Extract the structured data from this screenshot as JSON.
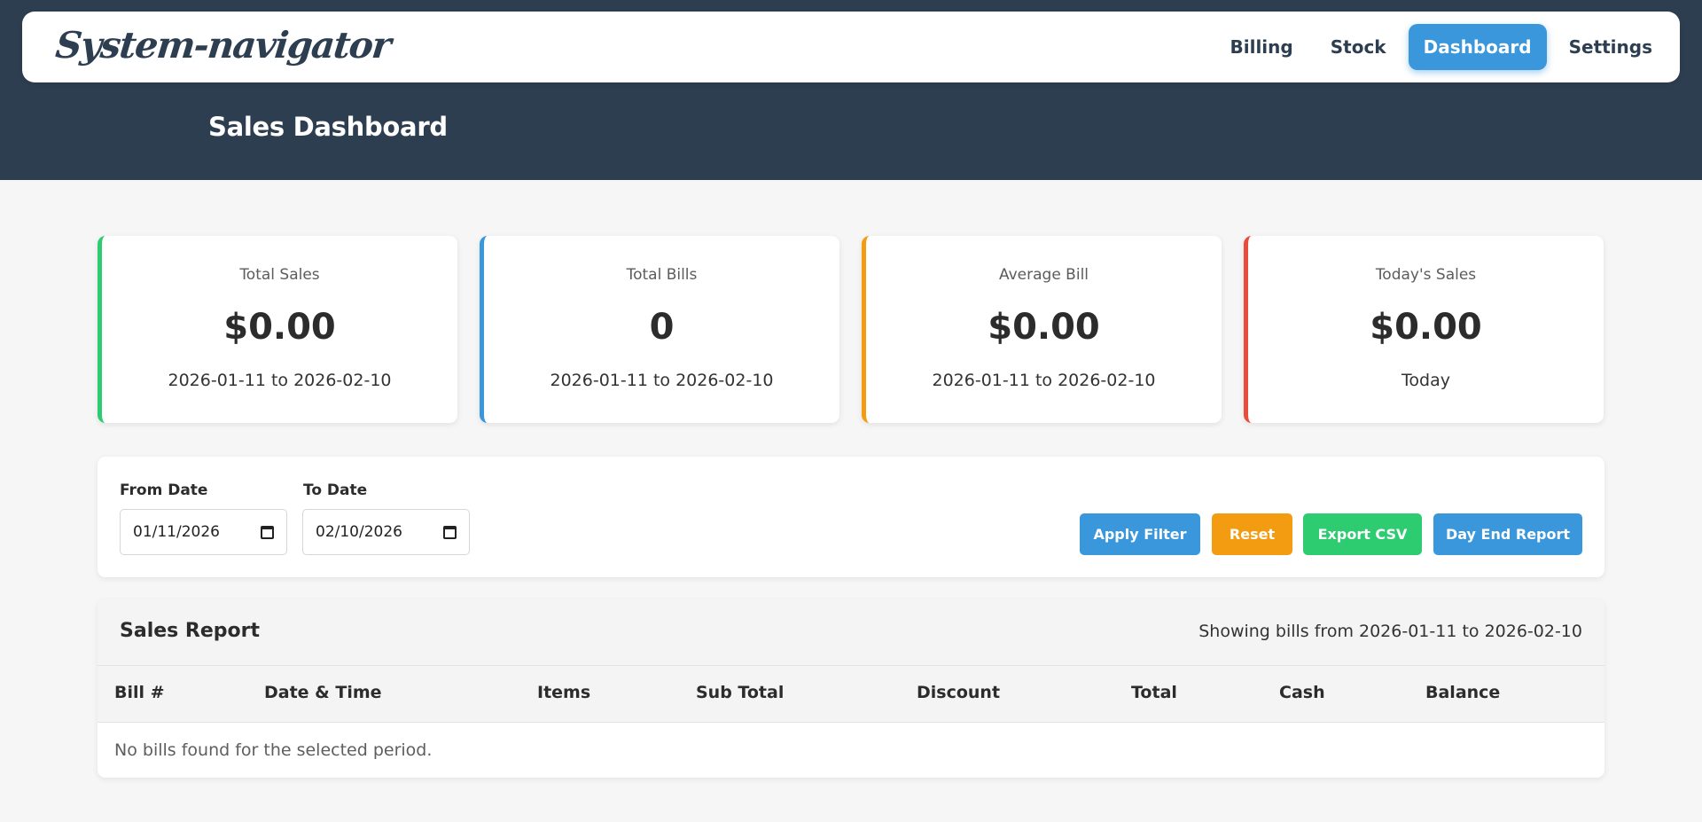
{
  "app": {
    "brand": "System-navigator",
    "page_title": "Sales Dashboard"
  },
  "nav": {
    "items": [
      {
        "label": "Billing",
        "active": false
      },
      {
        "label": "Stock",
        "active": false
      },
      {
        "label": "Dashboard",
        "active": true
      },
      {
        "label": "Settings",
        "active": false
      }
    ]
  },
  "stats": [
    {
      "label": "Total Sales",
      "value": "$0.00",
      "sub": "2026-01-11 to 2026-02-10",
      "accent": "#2ecc71"
    },
    {
      "label": "Total Bills",
      "value": "0",
      "sub": "2026-01-11 to 2026-02-10",
      "accent": "#3a97dc"
    },
    {
      "label": "Average Bill",
      "value": "$0.00",
      "sub": "2026-01-11 to 2026-02-10",
      "accent": "#f39c12"
    },
    {
      "label": "Today's Sales",
      "value": "$0.00",
      "sub": "Today",
      "accent": "#e74c3c"
    }
  ],
  "filters": {
    "from_label": "From Date",
    "from_value": "01/11/2026",
    "to_label": "To Date",
    "to_value": "02/10/2026",
    "buttons": {
      "apply": "Apply Filter",
      "reset": "Reset",
      "export": "Export CSV",
      "day_end": "Day End Report"
    },
    "colors": {
      "apply": "#3a97dc",
      "reset": "#f39c12",
      "export": "#2ecc71",
      "day_end": "#3a97dc"
    }
  },
  "report": {
    "title": "Sales Report",
    "range_text": "Showing bills from 2026-01-11 to 2026-02-10",
    "columns": [
      "Bill #",
      "Date & Time",
      "Items",
      "Sub Total",
      "Discount",
      "Total",
      "Cash",
      "Balance"
    ],
    "empty_message": "No bills found for the selected period."
  },
  "colors": {
    "header_bg": "#2e3e51",
    "accent_blue": "#3a97dc"
  }
}
